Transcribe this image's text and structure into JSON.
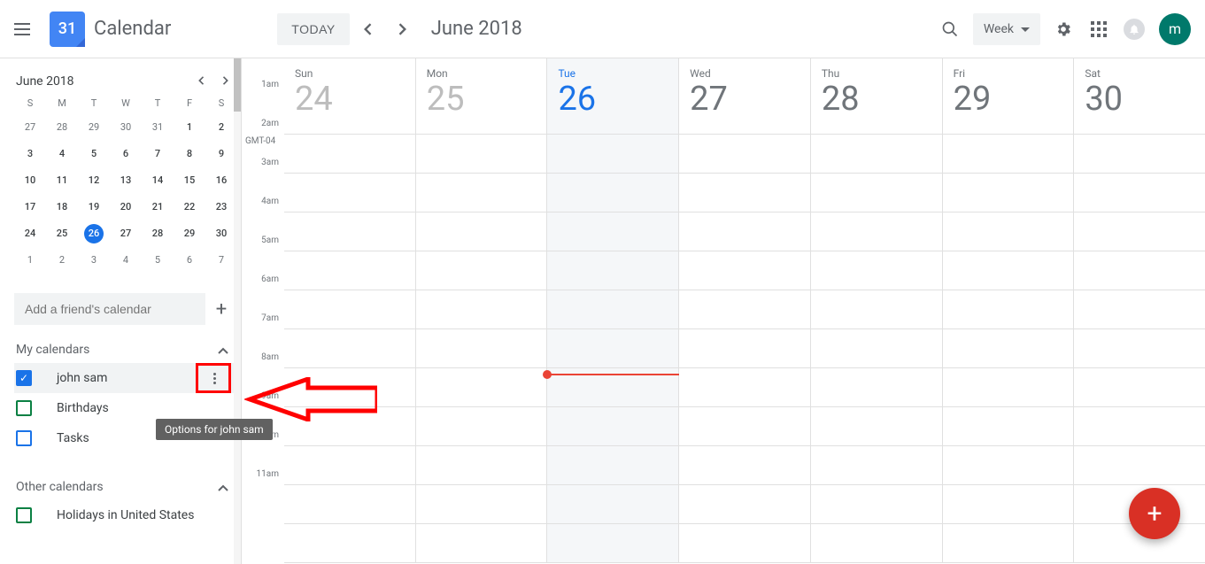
{
  "header": {
    "logo_day": "31",
    "app_title": "Calendar",
    "today_label": "TODAY",
    "month_label": "June 2018",
    "view_label": "Week",
    "avatar_letter": "m"
  },
  "mini": {
    "month_label": "June 2018",
    "days": [
      "S",
      "M",
      "T",
      "W",
      "T",
      "F",
      "S"
    ],
    "cells": [
      {
        "n": "27",
        "in": false
      },
      {
        "n": "28",
        "in": false
      },
      {
        "n": "29",
        "in": false
      },
      {
        "n": "30",
        "in": false
      },
      {
        "n": "31",
        "in": false
      },
      {
        "n": "1",
        "in": true
      },
      {
        "n": "2",
        "in": true
      },
      {
        "n": "3",
        "in": true
      },
      {
        "n": "4",
        "in": true
      },
      {
        "n": "5",
        "in": true
      },
      {
        "n": "6",
        "in": true
      },
      {
        "n": "7",
        "in": true
      },
      {
        "n": "8",
        "in": true
      },
      {
        "n": "9",
        "in": true
      },
      {
        "n": "10",
        "in": true
      },
      {
        "n": "11",
        "in": true
      },
      {
        "n": "12",
        "in": true
      },
      {
        "n": "13",
        "in": true
      },
      {
        "n": "14",
        "in": true
      },
      {
        "n": "15",
        "in": true
      },
      {
        "n": "16",
        "in": true
      },
      {
        "n": "17",
        "in": true
      },
      {
        "n": "18",
        "in": true
      },
      {
        "n": "19",
        "in": true
      },
      {
        "n": "20",
        "in": true
      },
      {
        "n": "21",
        "in": true
      },
      {
        "n": "22",
        "in": true
      },
      {
        "n": "23",
        "in": true
      },
      {
        "n": "24",
        "in": true
      },
      {
        "n": "25",
        "in": true
      },
      {
        "n": "26",
        "in": true,
        "today": true
      },
      {
        "n": "27",
        "in": true
      },
      {
        "n": "28",
        "in": true
      },
      {
        "n": "29",
        "in": true
      },
      {
        "n": "30",
        "in": true
      },
      {
        "n": "1",
        "in": false
      },
      {
        "n": "2",
        "in": false
      },
      {
        "n": "3",
        "in": false
      },
      {
        "n": "4",
        "in": false
      },
      {
        "n": "5",
        "in": false
      },
      {
        "n": "6",
        "in": false
      },
      {
        "n": "7",
        "in": false
      }
    ]
  },
  "add_friend_placeholder": "Add a friend's calendar",
  "my_calendars_label": "My calendars",
  "other_calendars_label": "Other calendars",
  "calendars": {
    "mine": [
      {
        "name": "john sam",
        "color": "#1a73e8",
        "checked": true,
        "hover": true
      },
      {
        "name": "Birthdays",
        "color": "#0b8043",
        "checked": false
      },
      {
        "name": "Tasks",
        "color": "#1a73e8",
        "checked": false
      }
    ],
    "other": [
      {
        "name": "Holidays in United States",
        "color": "#0b8043",
        "checked": false
      }
    ]
  },
  "tooltip_text": "Options for john sam",
  "week": {
    "tz": "GMT-04",
    "days": [
      {
        "dow": "Sun",
        "dom": "24",
        "past": true
      },
      {
        "dow": "Mon",
        "dom": "25",
        "past": true
      },
      {
        "dow": "Tue",
        "dom": "26",
        "today": true
      },
      {
        "dow": "Wed",
        "dom": "27"
      },
      {
        "dow": "Thu",
        "dom": "28"
      },
      {
        "dow": "Fri",
        "dom": "29"
      },
      {
        "dow": "Sat",
        "dom": "30"
      }
    ],
    "hours": [
      "1am",
      "2am",
      "3am",
      "4am",
      "5am",
      "6am",
      "7am",
      "8am",
      "9am",
      "10am",
      "11am"
    ]
  }
}
